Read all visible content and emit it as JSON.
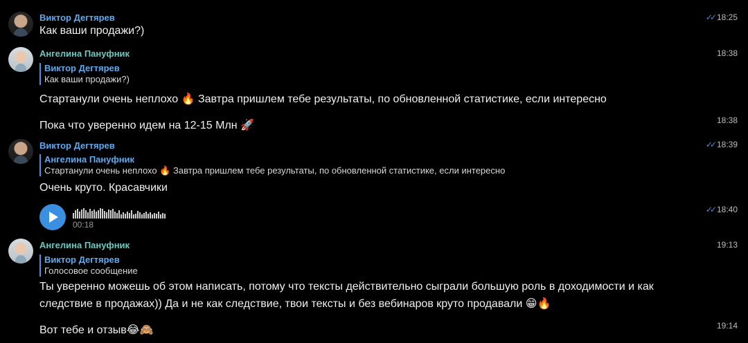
{
  "top_cut_text": "...",
  "messages": [
    {
      "sender": "Виктор Дегтярев",
      "text": "Как ваши продажи?)",
      "time": "18:25"
    },
    {
      "sender": "Ангелина Пануфник",
      "reply_name": "Виктор Дегтярев",
      "reply_text": "Как ваши продажи?)",
      "text": "Стартанули очень неплохо 🔥 Завтра пришлем тебе результаты, по обновленной статистике, если интересно",
      "time": "18:38"
    },
    {
      "text": "Пока что уверенно идем на 12-15 Млн 🚀",
      "time": "18:38"
    },
    {
      "sender": "Виктор Дегтярев",
      "reply_name": "Ангелина Пануфник",
      "reply_text": "Стартанули очень неплохо 🔥 Завтра пришлем тебе результаты, по обновленной статистике, если интересно",
      "text": "Очень круто. Красавчики",
      "time": "18:39"
    },
    {
      "voice_duration": "00:18",
      "time": "18:40"
    },
    {
      "sender": "Ангелина Пануфник",
      "reply_name": "Виктор Дегтярев",
      "reply_text": "Голосовое сообщение",
      "text_line1": "Ты уверенно можешь об этом написать, потому что тексты действительно сыграли большую роль в доходимости и как",
      "text_line2": "следствие в продажах)) Да и не как следствие, твои тексты и без вебинаров круто продавали 😁🔥",
      "time": "19:13"
    },
    {
      "text": "Вот тебе и отзыв😂🙈",
      "time": "19:14"
    }
  ],
  "icons": {
    "read": "double-check-icon",
    "play": "play-icon"
  }
}
